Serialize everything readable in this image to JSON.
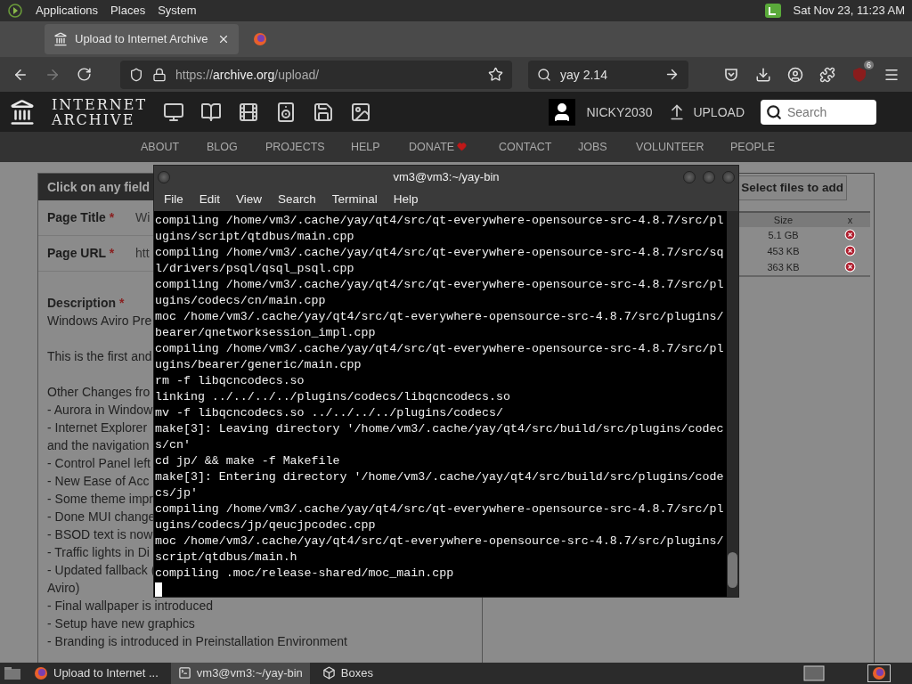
{
  "top_panel": {
    "menus": [
      "Applications",
      "Places",
      "System"
    ],
    "clock": "Sat Nov 23, 11:23 AM"
  },
  "browser": {
    "tabs": [
      {
        "kind": "archive",
        "title": "Upload to Internet Archive",
        "selected": true
      },
      {
        "kind": "firefox",
        "selected": false
      }
    ],
    "url_scheme": "https://",
    "url_host": "archive.org",
    "url_path": "/upload/",
    "search_value": "yay 2.14",
    "extension_badge": "6"
  },
  "site": {
    "logo": [
      "INTERNET",
      "ARCHIVE"
    ],
    "user": "NICKY2030",
    "upload": "UPLOAD",
    "search_placeholder": "Search",
    "nav": [
      {
        "label": "ABOUT",
        "heart": false
      },
      {
        "label": "BLOG",
        "heart": false
      },
      {
        "label": "PROJECTS",
        "heart": false
      },
      {
        "label": "HELP",
        "heart": false
      },
      {
        "label": "DONATE",
        "heart": true
      },
      {
        "label": "CONTACT",
        "heart": false
      },
      {
        "label": "JOBS",
        "heart": false
      },
      {
        "label": "VOLUNTEER",
        "heart": false
      },
      {
        "label": "PEOPLE",
        "heart": false
      }
    ]
  },
  "form": {
    "header": "Click on any field",
    "fields": [
      {
        "label": "Page Title",
        "mark": "*",
        "value": "Wi"
      },
      {
        "label": "Page URL",
        "mark": "*",
        "value": "htt"
      }
    ],
    "description_label": "Description",
    "description_mark": "*",
    "description_paragraphs": [
      [
        "Windows Aviro Pre"
      ],
      [
        "This is the first and"
      ],
      [
        "Other Changes fro",
        "- Aurora in Window",
        "- Internet Explorer",
        "and the navigation",
        "- Control Panel left",
        "- New Ease of Acc",
        "- Some theme impr",
        "- Done MUI change",
        "- BSOD text is now",
        "- Traffic lights in Di",
        "- Updated fallback (",
        "Aviro)",
        "- Final wallpaper is introduced",
        "- Setup have new graphics",
        "- Branding is introduced in Preinstallation Environment"
      ]
    ]
  },
  "files": {
    "button": "Select files to add",
    "columns": [
      "Size",
      "x"
    ],
    "sizes": [
      "5.1 GB",
      "453 KB",
      "363 KB"
    ]
  },
  "terminal": {
    "title": "vm3@vm3:~/yay-bin",
    "menu": [
      "File",
      "Edit",
      "View",
      "Search",
      "Terminal",
      "Help"
    ],
    "lines": [
      "compiling /home/vm3/.cache/yay/qt4/src/qt-everywhere-opensource-src-4.8.7/src/pl",
      "ugins/script/qtdbus/main.cpp",
      "compiling /home/vm3/.cache/yay/qt4/src/qt-everywhere-opensource-src-4.8.7/src/sq",
      "l/drivers/psql/qsql_psql.cpp",
      "compiling /home/vm3/.cache/yay/qt4/src/qt-everywhere-opensource-src-4.8.7/src/pl",
      "ugins/codecs/cn/main.cpp",
      "moc /home/vm3/.cache/yay/qt4/src/qt-everywhere-opensource-src-4.8.7/src/plugins/",
      "bearer/qnetworksession_impl.cpp",
      "compiling /home/vm3/.cache/yay/qt4/src/qt-everywhere-opensource-src-4.8.7/src/pl",
      "ugins/bearer/generic/main.cpp",
      "rm -f libqcncodecs.so",
      "linking ../../../../plugins/codecs/libqcncodecs.so",
      "mv -f libqcncodecs.so ../../../../plugins/codecs/",
      "make[3]: Leaving directory '/home/vm3/.cache/yay/qt4/src/build/src/plugins/codec",
      "s/cn'",
      "cd jp/ && make -f Makefile",
      "make[3]: Entering directory '/home/vm3/.cache/yay/qt4/src/build/src/plugins/code",
      "cs/jp'",
      "compiling /home/vm3/.cache/yay/qt4/src/qt-everywhere-opensource-src-4.8.7/src/pl",
      "ugins/codecs/jp/qeucjpcodec.cpp",
      "moc /home/vm3/.cache/yay/qt4/src/qt-everywhere-opensource-src-4.8.7/src/plugins/",
      "script/qtdbus/main.h",
      "compiling .moc/release-shared/moc_main.cpp"
    ]
  },
  "taskbar": {
    "items": [
      {
        "kind": "browser",
        "label": "Upload to Internet ...",
        "selected": false
      },
      {
        "kind": "terminal",
        "label": "vm3@vm3:~/yay-bin",
        "selected": true
      },
      {
        "kind": "boxes",
        "label": "Boxes",
        "selected": false
      }
    ]
  }
}
